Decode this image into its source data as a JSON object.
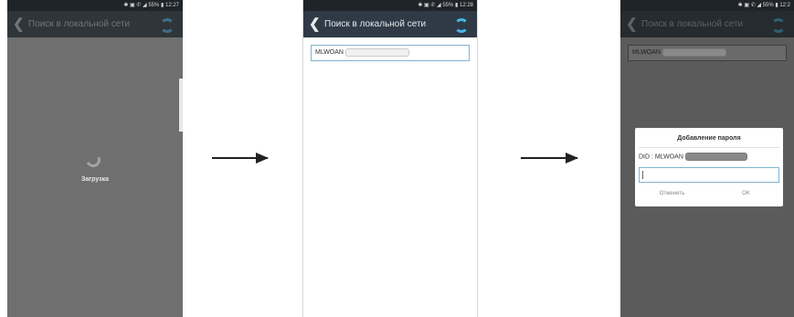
{
  "screens": [
    {
      "status": "✱ ▣ ✆ ◢ 55% ▮ 12:27",
      "title": "Поиск в локальной сети",
      "loading_text": "Загрузка"
    },
    {
      "status": "✱ ▣ ✆ ◢ 55% ▮ 12:28",
      "title": "Поиск в локальной сети",
      "device_label": "MLWOAN"
    },
    {
      "status": "✱ ▣ ✆ ◢ 55% ▮ 12:2",
      "title": "Поиск в локальной сети",
      "device_label": "MLWOAN",
      "dialog": {
        "title": "Добавление пароля",
        "did_label": "DID : MLWOAN",
        "cancel_label": "Отменить",
        "ok_label": "OK"
      }
    }
  ],
  "icons": {
    "back": "chevron-left-icon",
    "refresh": "refresh-icon"
  },
  "colors": {
    "appbar": "#2f3a46",
    "accent": "#46b3e6",
    "dim_overlay": "#6f6f6f"
  }
}
